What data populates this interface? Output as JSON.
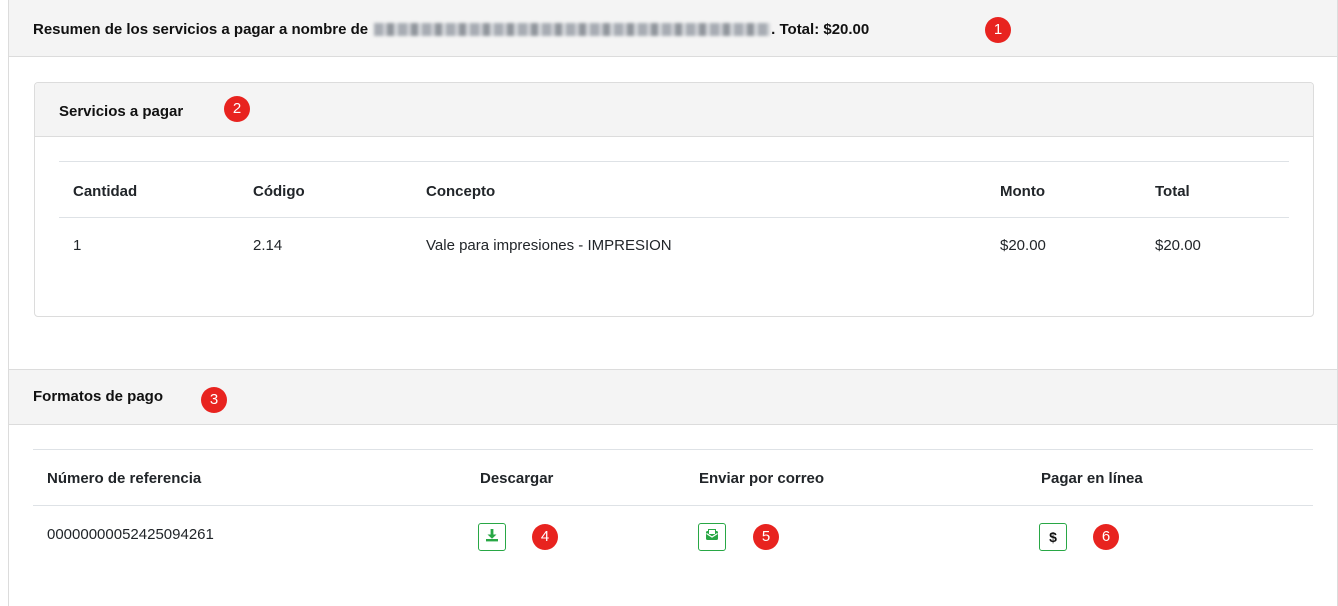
{
  "summary": {
    "prefix": "Resumen de los servicios a pagar a nombre de",
    "total_label": ". Total: $20.00",
    "badge": "1"
  },
  "services": {
    "title": "Servicios a pagar",
    "badge": "2",
    "columns": [
      "Cantidad",
      "Código",
      "Concepto",
      "Monto",
      "Total"
    ],
    "rows": [
      {
        "cantidad": "1",
        "codigo": "2.14",
        "concepto": "Vale para impresiones - IMPRESION",
        "monto": "$20.00",
        "total": "$20.00"
      }
    ]
  },
  "payment_formats": {
    "title": "Formatos de pago",
    "badge": "3",
    "columns": [
      "Número de referencia",
      "Descargar",
      "Enviar por correo",
      "Pagar en línea"
    ],
    "rows": [
      {
        "reference": "00000000052425094261",
        "download_icon": "download-icon",
        "email_icon": "envelope-icon",
        "pay_icon": "dollar-icon",
        "pay_glyph": "$"
      }
    ],
    "badges": [
      "4",
      "5",
      "6"
    ]
  },
  "colors": {
    "badge": "#e8231f",
    "button_border": "#28a745",
    "icon_green": "#28a745",
    "header_bg": "#f4f4f4"
  }
}
